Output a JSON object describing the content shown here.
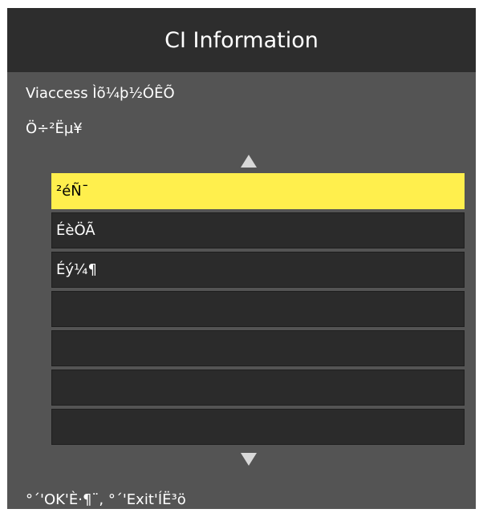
{
  "title": "CI Information",
  "info": {
    "line1": "Viaccess Ìõ¼þ½ÓÊÕ",
    "line2": "Ö÷²Ëµ¥"
  },
  "menu": {
    "selected_index": 0,
    "items": [
      {
        "label": "²éÑ¯"
      },
      {
        "label": "ÉèÖÃ"
      },
      {
        "label": "Éý¼¶"
      },
      {
        "label": ""
      },
      {
        "label": ""
      },
      {
        "label": ""
      },
      {
        "label": ""
      }
    ]
  },
  "icons": {
    "scroll_up": "triangle-up-icon",
    "scroll_down": "triangle-down-icon"
  },
  "footer": "°´'OK'È·¶¨, °´'Exit'ÍË³ö",
  "colors": {
    "background": "#545454",
    "titlebar": "#2d2d2d",
    "row": "#2b2b2b",
    "selected": "#ffef4d"
  }
}
